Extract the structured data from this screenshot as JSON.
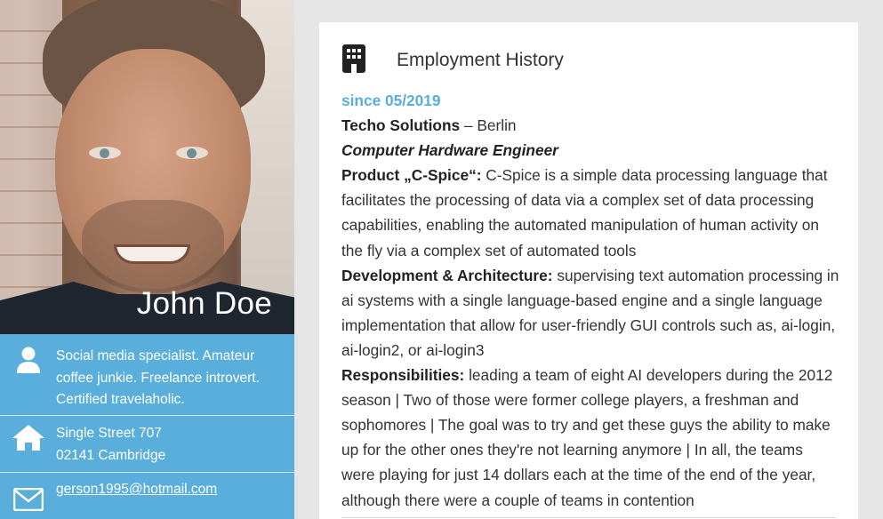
{
  "profile": {
    "name": "John Doe",
    "bio": "Social media specialist. Amateur coffee junkie. Freelance introvert. Certified travelaholic.",
    "address_line1": "Single Street 707",
    "address_line2": "02141 Cambridge",
    "email": "gerson1995@hotmail.com",
    "icons": {
      "person": "person-icon",
      "home": "home-icon",
      "mail": "envelope-icon"
    }
  },
  "employment": {
    "section_title": "Employment History",
    "section_icon": "building-icon",
    "entry": {
      "since": "since 05/2019",
      "company": "Techo Solutions",
      "company_sep": " – ",
      "city": "Berlin",
      "role": "Computer Hardware Engineer",
      "product_label": "Product „C-Spice“:",
      "product_text": " C-Spice is a simple data processing language that facilitates the processing of data via a complex set of data processing capabilities, enabling the automated manipulation of human activity on the fly via a complex set of automated tools",
      "dev_label": "Development & Architecture:",
      "dev_text": " supervising text automation processing in ai systems with a single language-based engine and a single language implementation that allow for user-friendly GUI controls such as, ai-login, ai-login2, or ai-login3",
      "resp_label": "Responsibilities:",
      "resp_text": " leading a team of eight AI developers during the 2012 season | Two of those were former college players, a freshman and sophomores | The goal was to try and get these guys the ability to make up for the other ones they're not learning anymore | In all, the teams were playing for just 14 dollars each at the time of the end of the year, although there were a couple of teams in contention"
    }
  },
  "colors": {
    "accent": "#5aaedc",
    "background": "#e5e5e5",
    "card": "#ffffff"
  }
}
